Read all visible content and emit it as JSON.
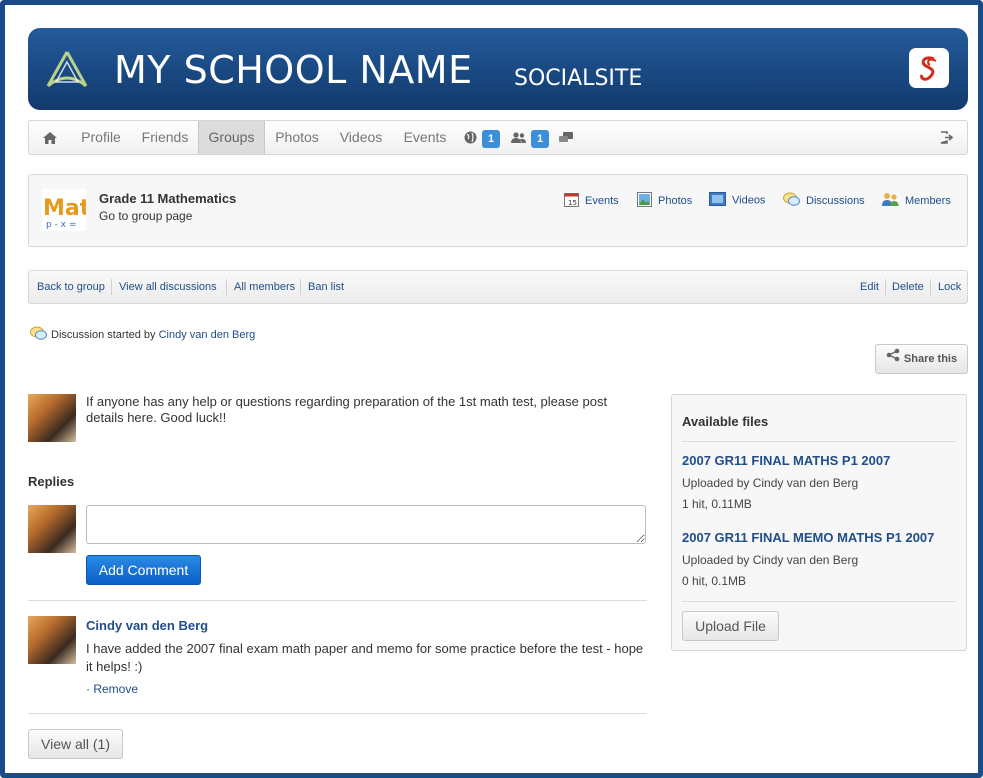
{
  "banner": {
    "title": "MY SCHOOL NAME",
    "subtitle": "SOCIALSITE",
    "colors": {
      "primary": "#1a4a84",
      "accent": "#d52b1e"
    }
  },
  "nav": {
    "items": [
      {
        "label": "Profile"
      },
      {
        "label": "Friends"
      },
      {
        "label": "Groups",
        "active": true
      },
      {
        "label": "Photos"
      },
      {
        "label": "Videos"
      },
      {
        "label": "Events"
      }
    ],
    "globe_count": "1",
    "friends_count": "1"
  },
  "group": {
    "name": "Grade 11 Mathematics",
    "link": "Go to group page",
    "tabs": [
      {
        "label": "Events",
        "icon": "calendar-icon"
      },
      {
        "label": "Photos",
        "icon": "photo-icon"
      },
      {
        "label": "Videos",
        "icon": "video-icon"
      },
      {
        "label": "Discussions",
        "icon": "chat-icon"
      },
      {
        "label": "Members",
        "icon": "members-icon"
      }
    ]
  },
  "toolbar": {
    "left": [
      {
        "label": "Back to group"
      },
      {
        "label": "View all discussions"
      },
      {
        "label": "All members"
      },
      {
        "label": "Ban list"
      }
    ],
    "right": [
      {
        "label": "Edit"
      },
      {
        "label": "Delete"
      },
      {
        "label": "Lock"
      }
    ]
  },
  "discussion": {
    "started_prefix": "Discussion started by",
    "started_by": "Cindy van den Berg",
    "share_label": "Share this",
    "body": "If anyone has any help or questions regarding preparation of the 1st math test, please post details here. Good luck!!"
  },
  "replies": {
    "heading": "Replies",
    "add_comment_label": "Add Comment",
    "items": [
      {
        "author": "Cindy van den Berg",
        "text": "I have added the 2007 final exam math paper and memo for some practice before the test - hope it helps! :)",
        "remove_label": "· Remove"
      }
    ],
    "view_all_label": "View all (1)"
  },
  "files": {
    "heading": "Available files",
    "items": [
      {
        "name": "2007 GR11 FINAL MATHS P1 2007",
        "uploaded": "Uploaded by Cindy van den Berg",
        "stats": "1 hit, 0.11MB"
      },
      {
        "name": "2007 GR11 FINAL MEMO MATHS P1 2007",
        "uploaded": "Uploaded by Cindy van den Berg",
        "stats": "0 hit, 0.1MB"
      }
    ],
    "upload_label": "Upload File"
  }
}
